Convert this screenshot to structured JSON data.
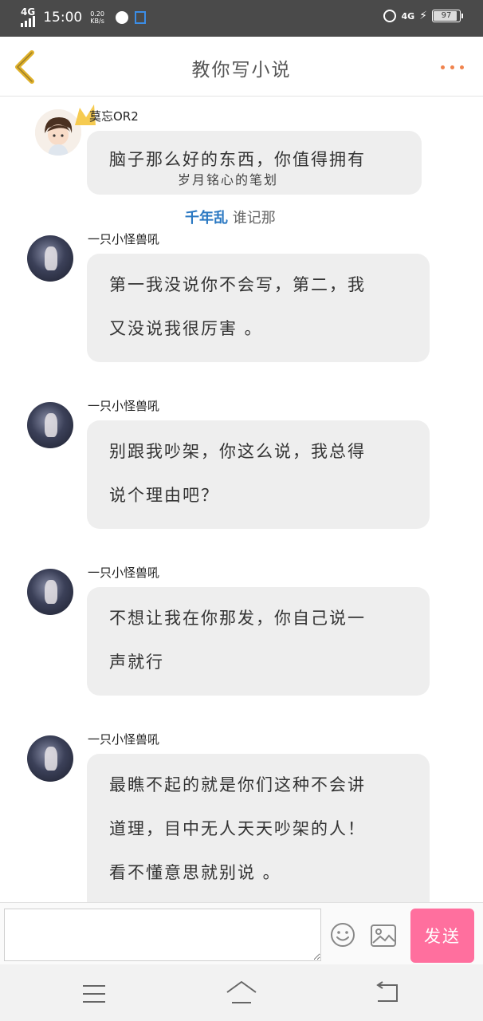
{
  "status_bar": {
    "network_left": "4G",
    "time": "15:00",
    "speed_value": "0.20",
    "speed_unit": "KB/s",
    "network_right": "4G",
    "battery": "97"
  },
  "header": {
    "title": "教你写小说"
  },
  "messages": [
    {
      "nickname": "莫忘OR2",
      "lines": [
        "脑子那么好的东西，你值得拥有"
      ],
      "signature": "岁月铭心的笔划",
      "tail_blue": "千年乱",
      "tail_grey": "谁记那"
    },
    {
      "nickname": "一只小怪兽吼",
      "lines": [
        "第一我没说你不会写，第二，我",
        "又没说我很厉害 。"
      ]
    },
    {
      "nickname": "一只小怪兽吼",
      "lines": [
        "别跟我吵架，你这么说，我总得",
        "说个理由吧？"
      ]
    },
    {
      "nickname": "一只小怪兽吼",
      "lines": [
        "不想让我在你那发，你自己说一",
        "声就行"
      ]
    },
    {
      "nickname": "一只小怪兽吼",
      "lines": [
        "最瞧不起的就是你们这种不会讲",
        "道理，目中无人天天吵架的人！",
        "看不懂意思就别说 。"
      ]
    }
  ],
  "input": {
    "value": "",
    "send_label": "发送"
  },
  "colors": {
    "status_bar_bg": "#4a4a4a",
    "accent_dots": "#f0834d",
    "send_button": "#ff6f9e",
    "bubble_bg": "#eeeeee",
    "tail_blue": "#2a78c2"
  }
}
